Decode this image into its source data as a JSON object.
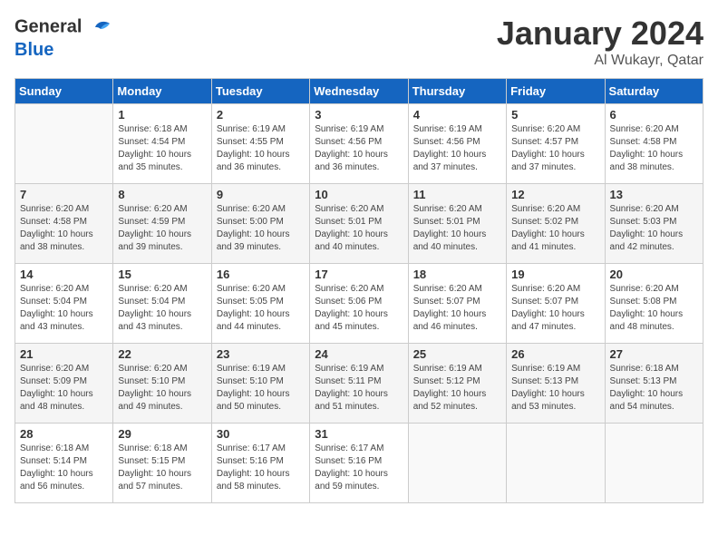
{
  "header": {
    "logo_line1": "General",
    "logo_line2": "Blue",
    "title": "January 2024",
    "subtitle": "Al Wukayr, Qatar"
  },
  "weekdays": [
    "Sunday",
    "Monday",
    "Tuesday",
    "Wednesday",
    "Thursday",
    "Friday",
    "Saturday"
  ],
  "weeks": [
    [
      {
        "day": "",
        "sunrise": "",
        "sunset": "",
        "daylight": ""
      },
      {
        "day": "1",
        "sunrise": "Sunrise: 6:18 AM",
        "sunset": "Sunset: 4:54 PM",
        "daylight": "Daylight: 10 hours and 35 minutes."
      },
      {
        "day": "2",
        "sunrise": "Sunrise: 6:19 AM",
        "sunset": "Sunset: 4:55 PM",
        "daylight": "Daylight: 10 hours and 36 minutes."
      },
      {
        "day": "3",
        "sunrise": "Sunrise: 6:19 AM",
        "sunset": "Sunset: 4:56 PM",
        "daylight": "Daylight: 10 hours and 36 minutes."
      },
      {
        "day": "4",
        "sunrise": "Sunrise: 6:19 AM",
        "sunset": "Sunset: 4:56 PM",
        "daylight": "Daylight: 10 hours and 37 minutes."
      },
      {
        "day": "5",
        "sunrise": "Sunrise: 6:20 AM",
        "sunset": "Sunset: 4:57 PM",
        "daylight": "Daylight: 10 hours and 37 minutes."
      },
      {
        "day": "6",
        "sunrise": "Sunrise: 6:20 AM",
        "sunset": "Sunset: 4:58 PM",
        "daylight": "Daylight: 10 hours and 38 minutes."
      }
    ],
    [
      {
        "day": "7",
        "sunrise": "Sunrise: 6:20 AM",
        "sunset": "Sunset: 4:58 PM",
        "daylight": "Daylight: 10 hours and 38 minutes."
      },
      {
        "day": "8",
        "sunrise": "Sunrise: 6:20 AM",
        "sunset": "Sunset: 4:59 PM",
        "daylight": "Daylight: 10 hours and 39 minutes."
      },
      {
        "day": "9",
        "sunrise": "Sunrise: 6:20 AM",
        "sunset": "Sunset: 5:00 PM",
        "daylight": "Daylight: 10 hours and 39 minutes."
      },
      {
        "day": "10",
        "sunrise": "Sunrise: 6:20 AM",
        "sunset": "Sunset: 5:01 PM",
        "daylight": "Daylight: 10 hours and 40 minutes."
      },
      {
        "day": "11",
        "sunrise": "Sunrise: 6:20 AM",
        "sunset": "Sunset: 5:01 PM",
        "daylight": "Daylight: 10 hours and 40 minutes."
      },
      {
        "day": "12",
        "sunrise": "Sunrise: 6:20 AM",
        "sunset": "Sunset: 5:02 PM",
        "daylight": "Daylight: 10 hours and 41 minutes."
      },
      {
        "day": "13",
        "sunrise": "Sunrise: 6:20 AM",
        "sunset": "Sunset: 5:03 PM",
        "daylight": "Daylight: 10 hours and 42 minutes."
      }
    ],
    [
      {
        "day": "14",
        "sunrise": "Sunrise: 6:20 AM",
        "sunset": "Sunset: 5:04 PM",
        "daylight": "Daylight: 10 hours and 43 minutes."
      },
      {
        "day": "15",
        "sunrise": "Sunrise: 6:20 AM",
        "sunset": "Sunset: 5:04 PM",
        "daylight": "Daylight: 10 hours and 43 minutes."
      },
      {
        "day": "16",
        "sunrise": "Sunrise: 6:20 AM",
        "sunset": "Sunset: 5:05 PM",
        "daylight": "Daylight: 10 hours and 44 minutes."
      },
      {
        "day": "17",
        "sunrise": "Sunrise: 6:20 AM",
        "sunset": "Sunset: 5:06 PM",
        "daylight": "Daylight: 10 hours and 45 minutes."
      },
      {
        "day": "18",
        "sunrise": "Sunrise: 6:20 AM",
        "sunset": "Sunset: 5:07 PM",
        "daylight": "Daylight: 10 hours and 46 minutes."
      },
      {
        "day": "19",
        "sunrise": "Sunrise: 6:20 AM",
        "sunset": "Sunset: 5:07 PM",
        "daylight": "Daylight: 10 hours and 47 minutes."
      },
      {
        "day": "20",
        "sunrise": "Sunrise: 6:20 AM",
        "sunset": "Sunset: 5:08 PM",
        "daylight": "Daylight: 10 hours and 48 minutes."
      }
    ],
    [
      {
        "day": "21",
        "sunrise": "Sunrise: 6:20 AM",
        "sunset": "Sunset: 5:09 PM",
        "daylight": "Daylight: 10 hours and 48 minutes."
      },
      {
        "day": "22",
        "sunrise": "Sunrise: 6:20 AM",
        "sunset": "Sunset: 5:10 PM",
        "daylight": "Daylight: 10 hours and 49 minutes."
      },
      {
        "day": "23",
        "sunrise": "Sunrise: 6:19 AM",
        "sunset": "Sunset: 5:10 PM",
        "daylight": "Daylight: 10 hours and 50 minutes."
      },
      {
        "day": "24",
        "sunrise": "Sunrise: 6:19 AM",
        "sunset": "Sunset: 5:11 PM",
        "daylight": "Daylight: 10 hours and 51 minutes."
      },
      {
        "day": "25",
        "sunrise": "Sunrise: 6:19 AM",
        "sunset": "Sunset: 5:12 PM",
        "daylight": "Daylight: 10 hours and 52 minutes."
      },
      {
        "day": "26",
        "sunrise": "Sunrise: 6:19 AM",
        "sunset": "Sunset: 5:13 PM",
        "daylight": "Daylight: 10 hours and 53 minutes."
      },
      {
        "day": "27",
        "sunrise": "Sunrise: 6:18 AM",
        "sunset": "Sunset: 5:13 PM",
        "daylight": "Daylight: 10 hours and 54 minutes."
      }
    ],
    [
      {
        "day": "28",
        "sunrise": "Sunrise: 6:18 AM",
        "sunset": "Sunset: 5:14 PM",
        "daylight": "Daylight: 10 hours and 56 minutes."
      },
      {
        "day": "29",
        "sunrise": "Sunrise: 6:18 AM",
        "sunset": "Sunset: 5:15 PM",
        "daylight": "Daylight: 10 hours and 57 minutes."
      },
      {
        "day": "30",
        "sunrise": "Sunrise: 6:17 AM",
        "sunset": "Sunset: 5:16 PM",
        "daylight": "Daylight: 10 hours and 58 minutes."
      },
      {
        "day": "31",
        "sunrise": "Sunrise: 6:17 AM",
        "sunset": "Sunset: 5:16 PM",
        "daylight": "Daylight: 10 hours and 59 minutes."
      },
      {
        "day": "",
        "sunrise": "",
        "sunset": "",
        "daylight": ""
      },
      {
        "day": "",
        "sunrise": "",
        "sunset": "",
        "daylight": ""
      },
      {
        "day": "",
        "sunrise": "",
        "sunset": "",
        "daylight": ""
      }
    ]
  ]
}
